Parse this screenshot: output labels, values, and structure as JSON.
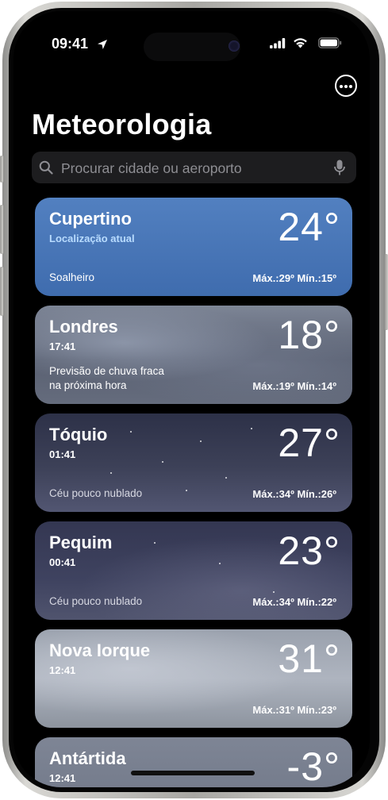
{
  "status_bar": {
    "time": "09:41",
    "icons": [
      "location-arrow-icon",
      "cellular-signal-icon",
      "wifi-icon",
      "battery-icon"
    ]
  },
  "header": {
    "more_icon": "ellipsis-circle-icon",
    "title": "Meteorologia"
  },
  "search": {
    "placeholder": "Procurar cidade ou aeroporto",
    "icons": [
      "search-icon",
      "microphone-icon"
    ]
  },
  "locations": [
    {
      "city": "Cupertino",
      "subtitle": "Localização atual",
      "temperature": "24°",
      "condition": "Soalheiro",
      "hilo": "Máx.:29º Mín.:15º"
    },
    {
      "city": "Londres",
      "subtitle": "17:41",
      "temperature": "18°",
      "condition_line1": "Previsão de chuva fraca",
      "condition_line2": "na próxima hora",
      "hilo": "Máx.:19º Mín.:14º"
    },
    {
      "city": "Tóquio",
      "subtitle": "01:41",
      "temperature": "27°",
      "condition": "Céu pouco nublado",
      "hilo": "Máx.:34º Mín.:26º"
    },
    {
      "city": "Pequim",
      "subtitle": "00:41",
      "temperature": "23°",
      "condition": "Céu pouco nublado",
      "hilo": "Máx.:34º Mín.:22º"
    },
    {
      "city": "Nova Iorque",
      "subtitle": "12:41",
      "temperature": "31°",
      "hilo": "Máx.:31º Mín.:23º"
    },
    {
      "city": "Antártida",
      "subtitle": "12:41",
      "temperature": "-3°"
    }
  ],
  "colors": {
    "background": "#000000",
    "cupertino_card": "#4a78b8",
    "current_location_label": "#b9dcff"
  }
}
